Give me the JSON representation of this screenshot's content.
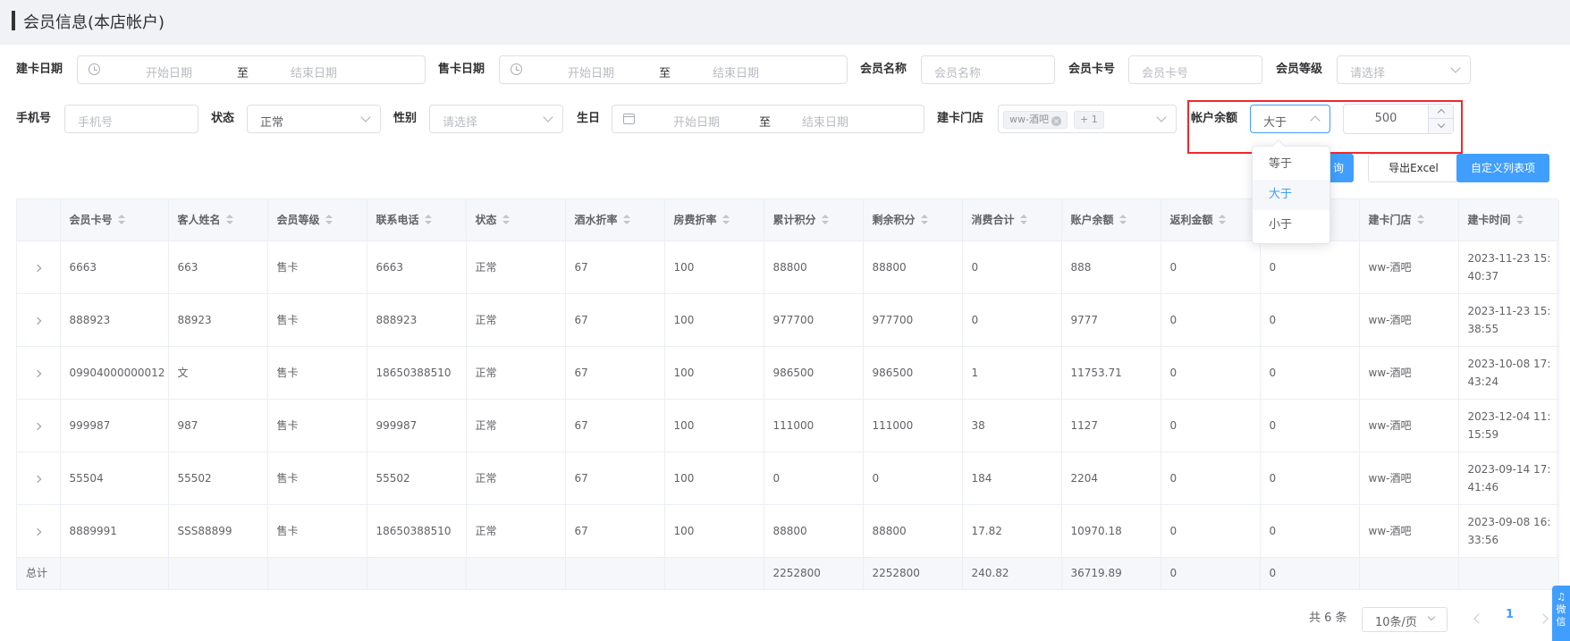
{
  "page": {
    "title": "会员信息(本店帐户)"
  },
  "filters": {
    "card_create_date": {
      "label": "建卡日期",
      "start_placeholder": "开始日期",
      "separator": "至",
      "end_placeholder": "结束日期"
    },
    "card_sale_date": {
      "label": "售卡日期",
      "start_placeholder": "开始日期",
      "separator": "至",
      "end_placeholder": "结束日期"
    },
    "member_name": {
      "label": "会员名称",
      "placeholder": "会员名称"
    },
    "member_card_no": {
      "label": "会员卡号",
      "placeholder": "会员卡号"
    },
    "member_level": {
      "label": "会员等级",
      "placeholder": "请选择"
    },
    "phone": {
      "label": "手机号",
      "placeholder": "手机号"
    },
    "status": {
      "label": "状态",
      "value": "正常"
    },
    "gender": {
      "label": "性别",
      "placeholder": "请选择"
    },
    "birthday": {
      "label": "生日",
      "start_placeholder": "开始日期",
      "separator": "至",
      "end_placeholder": "结束日期"
    },
    "create_store": {
      "label": "建卡门店",
      "tag": "ww-酒吧",
      "tag_close": "×",
      "more": "+ 1"
    },
    "account_balance": {
      "label": "帐户余额",
      "operator": "大于",
      "value": "500",
      "options": [
        "等于",
        "大于",
        "小于"
      ]
    }
  },
  "actions": {
    "query": "查询",
    "query_visible": "询",
    "export": "导出Excel",
    "customize_columns": "自定义列表项"
  },
  "table": {
    "columns": [
      "会员卡号",
      "客人姓名",
      "会员等级",
      "联系电话",
      "状态",
      "酒水折率",
      "房费折率",
      "累计积分",
      "剩余积分",
      "消费合计",
      "账户余额",
      "返利金额",
      "",
      "建卡门店",
      "建卡时间"
    ],
    "rows": [
      [
        "6663",
        "663",
        "售卡",
        "6663",
        "正常",
        "67",
        "100",
        "88800",
        "88800",
        "0",
        "888",
        "0",
        "0",
        "ww-酒吧",
        "2023-11-23 15:",
        "40:37"
      ],
      [
        "888923",
        "88923",
        "售卡",
        "888923",
        "正常",
        "67",
        "100",
        "977700",
        "977700",
        "0",
        "9777",
        "0",
        "0",
        "ww-酒吧",
        "2023-11-23 15:",
        "38:55"
      ],
      [
        "09904000000012",
        "文",
        "售卡",
        "18650388510",
        "正常",
        "67",
        "100",
        "986500",
        "986500",
        "1",
        "11753.71",
        "0",
        "0",
        "ww-酒吧",
        "2023-10-08 17:",
        "43:24"
      ],
      [
        "999987",
        "987",
        "售卡",
        "999987",
        "正常",
        "67",
        "100",
        "111000",
        "111000",
        "38",
        "1127",
        "0",
        "0",
        "ww-酒吧",
        "2023-12-04 11:",
        "15:59"
      ],
      [
        "55504",
        "55502",
        "售卡",
        "55502",
        "正常",
        "67",
        "100",
        "0",
        "0",
        "184",
        "2204",
        "0",
        "0",
        "ww-酒吧",
        "2023-09-14 17:",
        "41:46"
      ],
      [
        "8889991",
        "SSS88899",
        "售卡",
        "18650388510",
        "正常",
        "67",
        "100",
        "88800",
        "88800",
        "17.82",
        "10970.18",
        "0",
        "0",
        "ww-酒吧",
        "2023-09-08 16:",
        "33:56"
      ]
    ],
    "totals": {
      "label": "总计",
      "cumulative_points": "2252800",
      "remaining_points": "2252800",
      "consumption": "240.82",
      "balance": "36719.89",
      "rebate": "0",
      "extra": "0"
    }
  },
  "pagination": {
    "total_text": "共 6 条",
    "page_size": "10条/页",
    "current_page": "1"
  },
  "side_widget": {
    "label": "微信"
  },
  "colors": {
    "primary": "#409eff",
    "highlight_border": "#f0282d",
    "header_bg": "#f0f2f5"
  }
}
